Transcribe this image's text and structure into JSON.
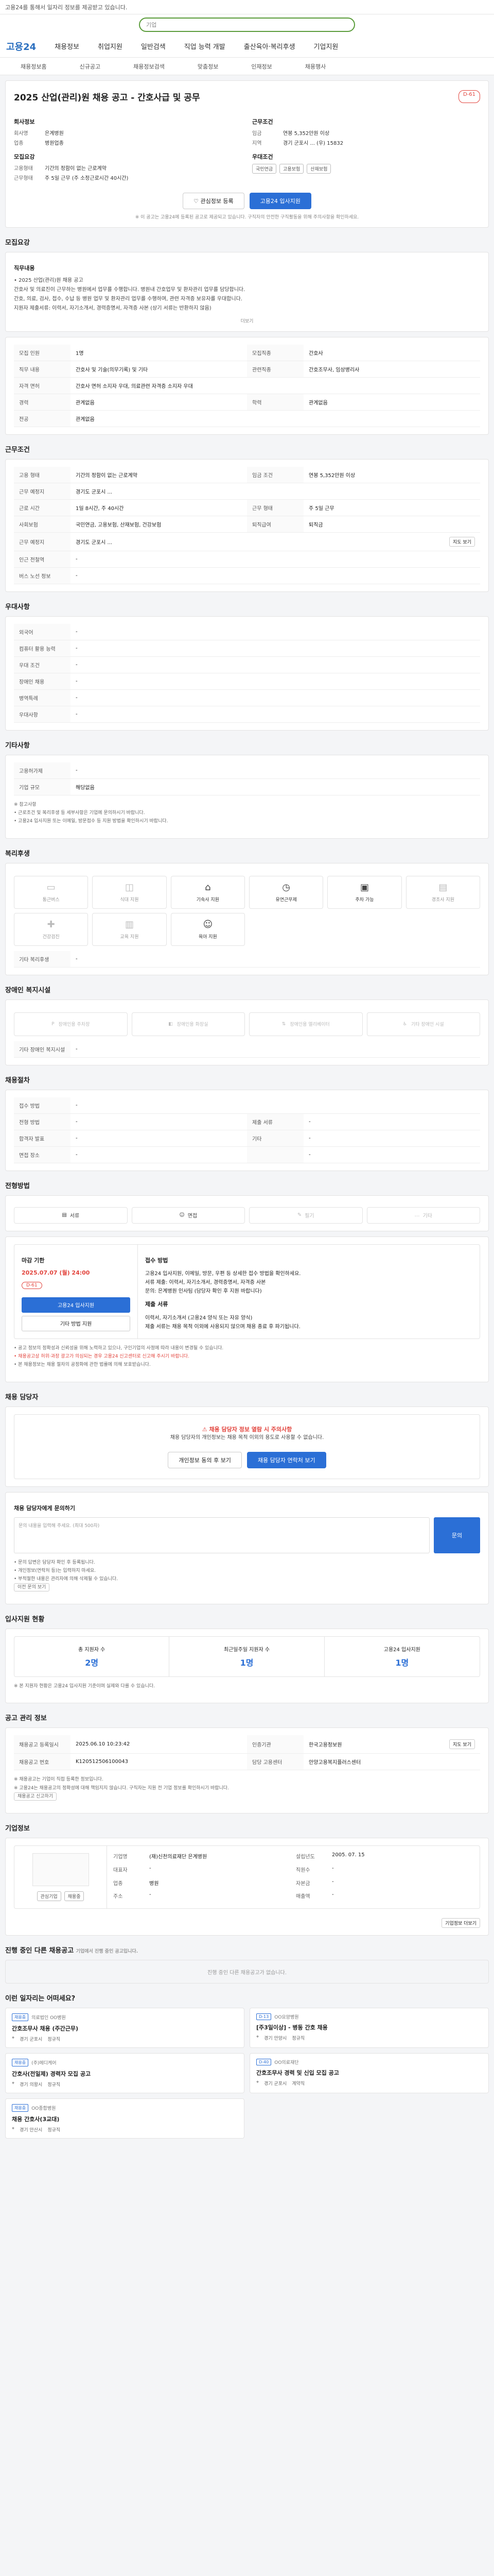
{
  "top_banner": "고용24를 통해서 일자리 정보를 제공받고 있습니다.",
  "search": {
    "placeholder": "기업"
  },
  "nav": {
    "logo": "고용24",
    "items": [
      "채용정보",
      "취업지원",
      "일반검색",
      "직업 능력 개발",
      "출산육아·복리후생",
      "기업지원"
    ]
  },
  "subnav": [
    "채용정보홈",
    "신규공고",
    "채용정보검색",
    "맞춤정보",
    "인재정보",
    "채용행사"
  ],
  "job": {
    "badge": "D-61",
    "title": "2025 산업(관리)원 채용 공고 - 간호사급 및 공무",
    "company_section": "회사정보",
    "company_rows": [
      {
        "k": "회사명",
        "v": "은계병원"
      },
      {
        "k": "업종",
        "v": "병원업종"
      }
    ],
    "hire_section": "모집요강",
    "hire_rows": [
      {
        "k": "고용형태",
        "v": "기간의 정함이 없는 근로계약"
      },
      {
        "k": "근무형태",
        "v": "주 5일 근무 (주 소정근로시간 40시간)"
      }
    ],
    "cond_section": "근무조건",
    "cond_rows": [
      {
        "k": "임금",
        "v": "연봉 5,352만원 이상"
      },
      {
        "k": "지역",
        "v": "경기 군포시 ... (우) 15832"
      }
    ],
    "pref_section": "우대조건",
    "tags": [
      "국민연금",
      "고용보험",
      "산재보험"
    ],
    "btn_interest": "관심정보 등록",
    "btn_apply": "고용24 입사지원",
    "notice": "※ 이 공고는 고용24에 등록된 공고로 제공되고 있습니다. 구직자의 안전한 구직활동을 위해 주의사항을 확인하세요."
  },
  "summary": {
    "head": "모집요강",
    "sub": "직무내용",
    "lines": [
      "• 2025 산업(관리)원 채용 공고",
      "간호사 및 의료진이 근무하는 병원에서 업무를 수행합니다. 병원내 간호업무 및 환자관리 업무를 담당합니다.",
      "간호, 의료, 검사, 접수, 수납 등 병원 업무 및 환자관리 업무를 수행하며, 관련 자격증 보유자를 우대합니다.",
      "지원자 제출서류: 이력서, 자기소개서, 경력증명서, 자격증 사본 (상기 서류는 반환하지 않음)"
    ],
    "more": "더보기"
  },
  "detail_rows": [
    {
      "k": "모집 인원",
      "v": "1명",
      "k2": "모집직종",
      "v2": "간호사"
    },
    {
      "k": "직무 내용",
      "v": "간호사 및 기술(의무기록) 및 기타",
      "k2": "관련직종",
      "v2": "간호조무사, 임상병리사"
    },
    {
      "k": "자격 면허",
      "v": "간호사 면허 소지자 우대, 의료관련 자격증 소지자 우대",
      "k2": "",
      "v2": ""
    },
    {
      "k": "경력",
      "v": "관계없음",
      "k2": "학력",
      "v2": "관계없음"
    },
    {
      "k": "전공",
      "v": "관계없음",
      "k2": "",
      "v2": ""
    }
  ],
  "conditions": {
    "head": "근무조건",
    "employment": "기간의 정함이 없는 근로계약",
    "pay_label": "임금 조건",
    "pay": "연봉 5,352만원 이상",
    "loc_label": "근무 예정지",
    "location": "경기도 군포시 ...",
    "rows": [
      {
        "k": "근로 시간",
        "v": "1일 8시간, 주 40시간",
        "k2": "근무 형태",
        "v2": "주 5일 근무"
      },
      {
        "k": "사회보험",
        "v": "국민연금, 고용보험, 산재보험, 건강보험",
        "k2": "퇴직급여",
        "v2": "퇴직금"
      },
      {
        "k": "근무 예정지",
        "v": "경기도 군포시 ...",
        "k2": "",
        "v2": ""
      },
      {
        "k": "인근 전철역",
        "v": "-",
        "k2": "",
        "v2": ""
      },
      {
        "k": "버스 노선 정보",
        "v": "-",
        "k2": "",
        "v2": ""
      }
    ],
    "more": "지도 보기"
  },
  "preferences": {
    "head": "우대사항",
    "rows": [
      {
        "k": "외국어",
        "v": "-"
      },
      {
        "k": "컴퓨터 활용 능력",
        "v": "-"
      },
      {
        "k": "우대 조건",
        "v": "-"
      },
      {
        "k": "장애인 채용",
        "v": "-"
      },
      {
        "k": "병역특례",
        "v": "-"
      },
      {
        "k": "우대사항",
        "v": "-"
      }
    ]
  },
  "others": {
    "head": "기타사항",
    "rows": [
      {
        "k": "고용허가제",
        "v": "-"
      },
      {
        "k": "기업 규모",
        "v": "해당없음"
      }
    ],
    "notes": [
      "※ 참고사항",
      "• 근로조건 및 복리후생 등 세부사항은 기업에 문의하시기 바랍니다.",
      "• 고용24 입사지원 또는 이메일, 방문접수 등 지원 방법을 확인하시기 바랍니다."
    ]
  },
  "welfare": {
    "head": "복리후생",
    "items": [
      {
        "icon": "money-icon",
        "label": "통근버스",
        "on": false
      },
      {
        "icon": "meal-icon",
        "label": "식대 지원",
        "on": false
      },
      {
        "icon": "house-icon",
        "label": "기숙사 지원",
        "on": true
      },
      {
        "icon": "clock-icon",
        "label": "유연근무제",
        "on": true
      },
      {
        "icon": "car-icon",
        "label": "주차 가능",
        "on": true
      },
      {
        "icon": "gift-icon",
        "label": "경조사 지원",
        "on": false
      },
      {
        "icon": "health-icon",
        "label": "건강검진",
        "on": false
      },
      {
        "icon": "book-icon",
        "label": "교육 지원",
        "on": false
      },
      {
        "icon": "baby-icon",
        "label": "육아 지원",
        "on": true
      }
    ],
    "other_label": "기타 복리후생",
    "other_value": "-"
  },
  "disability": {
    "head": "장애인 복지시설",
    "items": [
      "장애인용 주차장",
      "장애인용 화장실",
      "장애인용 엘리베이터",
      "기타 장애인 시설"
    ],
    "other_label": "기타 장애인 복지시설",
    "other_value": "-"
  },
  "process": {
    "head": "채용절차",
    "rows": [
      {
        "k": "접수 방법",
        "v": "-",
        "k2": "",
        "v2": ""
      },
      {
        "k": "전형 방법",
        "v": "-",
        "k2": "제출 서류",
        "v2": "-"
      },
      {
        "k": "합격자 발표",
        "v": "-",
        "k2": "기타",
        "v2": "-"
      },
      {
        "k": "면접 장소",
        "v": "-",
        "k2": "",
        "v2": "-"
      }
    ]
  },
  "apply_methods": {
    "head": "전형방법",
    "items": [
      "서류",
      "면접",
      "필기",
      "기타"
    ]
  },
  "apply": {
    "head": "접수 방법",
    "deadline_label": "마감 기한",
    "deadline": "2025.07.07 (월) 24:00",
    "dday": "D-61",
    "btn_apply": "고용24 입사지원",
    "btn_other": "기타 방법 지원",
    "method_head": "접수 방법",
    "method_lines": [
      "고용24 입사지원, 이메일, 방문, 우편 등 상세한 접수 방법을 확인하세요.",
      "서류 제출: 이력서, 자기소개서, 경력증명서, 자격증 사본",
      "문의: 은계병원 인사팀 (담당자 확인 후 지원 바랍니다)"
    ],
    "extra_head": "제출 서류",
    "extra_lines": [
      "이력서, 자기소개서 (고용24 양식 또는 자유 양식)",
      "제출 서류는 채용 목적 이외에 사용되지 않으며 채용 종료 후 파기됩니다."
    ]
  },
  "bullets": [
    "• 공고 정보의 정확성과 신뢰성을 위해 노력하고 있으나, 구인기업의 사정에 따라 내용이 변경될 수 있습니다.",
    "• 채용공고상 허위·과장 광고가 의심되는 경우 고용24 신고센터로 신고해 주시기 바랍니다.",
    "• 본 채용정보는 채용 절차의 공정화에 관한 법률에 의해 보호받습니다."
  ],
  "recruiter": {
    "head": "채용 담당자",
    "warn": "채용 담당자 정보 열람 시 주의사항",
    "text": "채용 담당자의 개인정보는 채용 목적 이외의 용도로 사용할 수 없습니다.",
    "btn_view": "개인정보 동의 후 보기",
    "btn_contact": "채용 담당자 연락처 보기"
  },
  "inquiry": {
    "head": "채용 담당자에게 문의하기",
    "placeholder": "문의 내용을 입력해 주세요. (최대 500자)",
    "btn": "문의",
    "notes": [
      "• 문의 답변은 담당자 확인 후 등록됩니다.",
      "• 개인정보(연락처 등)는 입력하지 마세요.",
      "• 부적절한 내용은 관리자에 의해 삭제될 수 있습니다."
    ],
    "link": "이전 문의 보기"
  },
  "stats": {
    "head": "입사지원 현황",
    "items": [
      {
        "label": "총 지원자 수",
        "value": "2명"
      },
      {
        "label": "최근일주일 지원자 수",
        "value": "1명"
      },
      {
        "label": "고용24 입사지원",
        "value": "1명"
      }
    ],
    "note": "※ 본 지원자 현황은 고용24 입사지원 기준이며 실제와 다를 수 있습니다."
  },
  "manage": {
    "head": "공고 관리 정보",
    "rows": [
      {
        "k": "채용공고 등록일시",
        "v": "2025.06.10 10:23:42",
        "k2": "인증기관",
        "v2": "한국고용정보원"
      },
      {
        "k": "채용공고 번호",
        "v": "K120512506100043",
        "k2": "담당 고용센터",
        "v2": "안양고용복지플러스센터"
      }
    ],
    "more": "지도 보기",
    "notes": [
      "※ 채용공고는 기업이 직접 등록한 정보입니다.",
      "※ 고용24는 채용공고의 정확성에 대해 책임지지 않습니다. 구직자는 지원 전 기업 정보를 확인하시기 바랍니다."
    ],
    "link": "채용공고 신고하기"
  },
  "company": {
    "head": "기업정보",
    "btn_interest": "관심기업",
    "btn_jobs": "채용중",
    "rows": [
      {
        "k": "기업명",
        "v": "(재)신천의료재단 은계병원",
        "k2": "설립년도",
        "v2": "2005. 07. 15"
      },
      {
        "k": "대표자",
        "v": "-",
        "k2": "직원수",
        "v2": "-"
      },
      {
        "k": "업종",
        "v": "병원",
        "k2": "자본금",
        "v2": "-"
      },
      {
        "k": "주소",
        "v": "-",
        "k2": "매출액",
        "v2": "-"
      }
    ],
    "more": "기업정보 더보기"
  },
  "others_jobs": {
    "head": "진행 중인 다른 채용공고",
    "empty": "진행 중인 다른 채용공고가 없습니다.",
    "hint": "기업에서 진행 중인 공고입니다."
  },
  "recommend": {
    "head": "이런 일자리는 어떠세요?",
    "items": [
      {
        "badge": "채용중",
        "org": "의료법인 OO병원",
        "title": "간호조무사 채용 (주간근무)",
        "loc": "경기 군포시",
        "type": "정규직"
      },
      {
        "badge": "D-13",
        "org": "OO요양병원",
        "title": "[주3일이상] - 병동 간호 채용",
        "loc": "경기 안양시",
        "type": "정규직"
      },
      {
        "badge": "채용중",
        "org": "(주)메디케어",
        "title": "간호사(전일제) 경력자 모집 공고",
        "loc": "경기 의왕시",
        "type": "정규직"
      },
      {
        "badge": "D-40",
        "org": "OO의료재단",
        "title": "간호조무사 경력 및 신입 모집 공고",
        "loc": "경기 군포시",
        "type": "계약직"
      },
      {
        "badge": "채용중",
        "org": "OO종합병원",
        "title": "채용 간호사(3교대)",
        "loc": "경기 안산시",
        "type": "정규직"
      }
    ]
  }
}
